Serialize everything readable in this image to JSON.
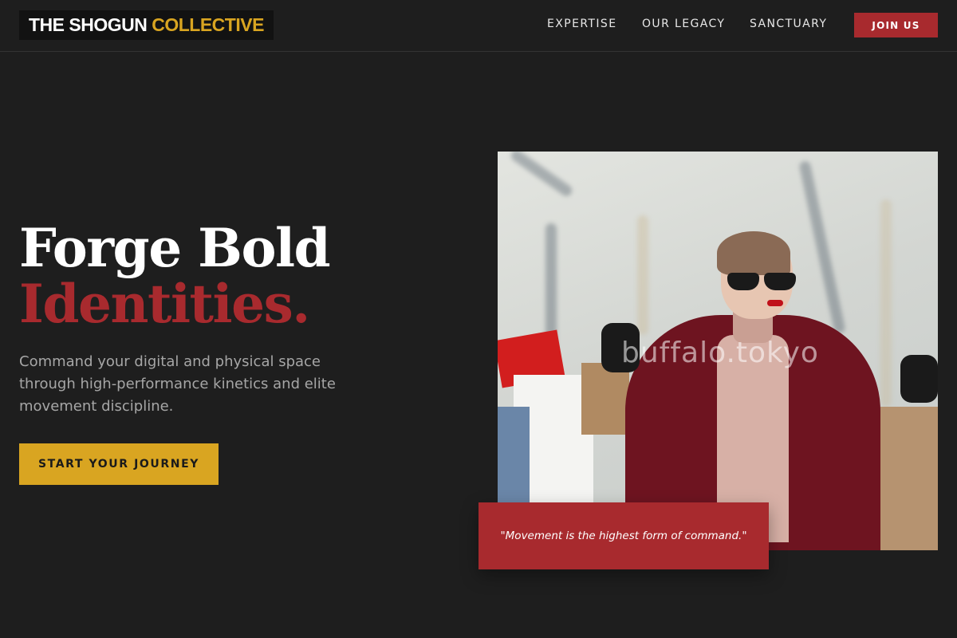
{
  "header": {
    "logo_main": "THE SHOGUN",
    "logo_accent": "COLLECTIVE",
    "nav": [
      {
        "label": "EXPERTISE"
      },
      {
        "label": "OUR LEGACY"
      },
      {
        "label": "SANCTUARY"
      }
    ],
    "join_label": "JOIN US"
  },
  "hero": {
    "headline_line1": "Forge Bold",
    "headline_line2": "Identities.",
    "subtext": "Command your digital and physical space through high-performance kinetics and elite movement discipline.",
    "cta_label": "START YOUR JOURNEY",
    "image_watermark": "buffalo.tokyo",
    "quote": "\"Movement is the highest form of command.\""
  },
  "colors": {
    "background": "#1e1e1e",
    "accent_red": "#a82a2e",
    "accent_gold": "#d9a521"
  }
}
